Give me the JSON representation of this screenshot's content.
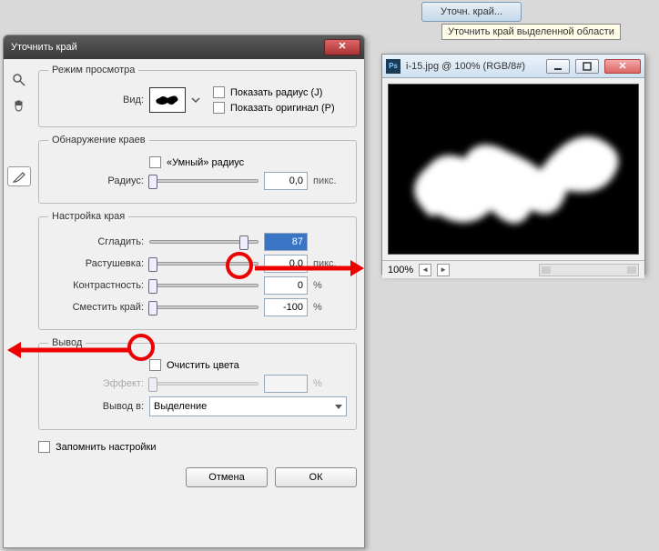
{
  "topButton": {
    "label": "Уточн. край..."
  },
  "tooltip": "Уточнить край выделенной области",
  "dialog": {
    "title": "Уточнить край",
    "sections": {
      "viewMode": {
        "legend": "Режим просмотра",
        "viewLabel": "Вид:",
        "showRadius": "Показать радиус (J)",
        "showOriginal": "Показать оригинал (P)"
      },
      "edgeDetect": {
        "legend": "Обнаружение краев",
        "smartRadius": "«Умный» радиус",
        "radiusLabel": "Радиус:",
        "radiusValue": "0,0",
        "radiusUnit": "пикс."
      },
      "edgeAdjust": {
        "legend": "Настройка края",
        "smoothLabel": "Сгладить:",
        "smoothValue": "87",
        "featherLabel": "Растушевка:",
        "featherValue": "0,0",
        "featherUnit": "пикс.",
        "contrastLabel": "Контрастность:",
        "contrastValue": "0",
        "contrastUnit": "%",
        "shiftLabel": "Сместить край:",
        "shiftValue": "-100",
        "shiftUnit": "%"
      },
      "output": {
        "legend": "Вывод",
        "cleanColors": "Очистить цвета",
        "effectLabel": "Эффект:",
        "effectUnit": "%",
        "outputTo": "Вывод в:",
        "outputValue": "Выделение"
      }
    },
    "remember": "Запомнить настройки",
    "cancel": "Отмена",
    "ok": "ОК"
  },
  "imageWindow": {
    "title": "i-15.jpg @ 100% (RGB/8#)",
    "zoom": "100%"
  }
}
